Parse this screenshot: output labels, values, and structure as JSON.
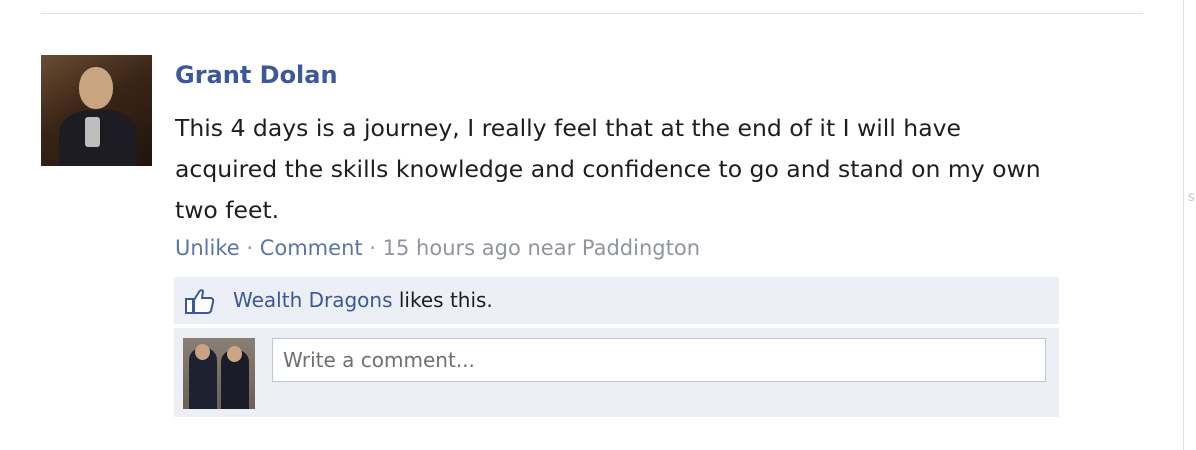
{
  "post": {
    "author": "Grant Dolan",
    "text": "This 4 days is a journey, I really feel that at the end of it I will have acquired the skills knowledge and confidence to go and stand on my own two feet.",
    "actions": {
      "unlike": "Unlike",
      "sep1": " · ",
      "comment": "Comment",
      "sep2": " · ",
      "time_location": "15 hours ago near Paddington"
    }
  },
  "likes": {
    "icon": "thumbs-up-icon",
    "liker": "Wealth Dragons",
    "suffix": " likes this."
  },
  "comment_box": {
    "placeholder": "Write a comment..."
  },
  "colors": {
    "link": "#3b5998",
    "meta_link": "#5b74a8",
    "meta_text": "#90949c",
    "panel_bg": "#eceff5"
  },
  "scrollbar_mark": "s"
}
